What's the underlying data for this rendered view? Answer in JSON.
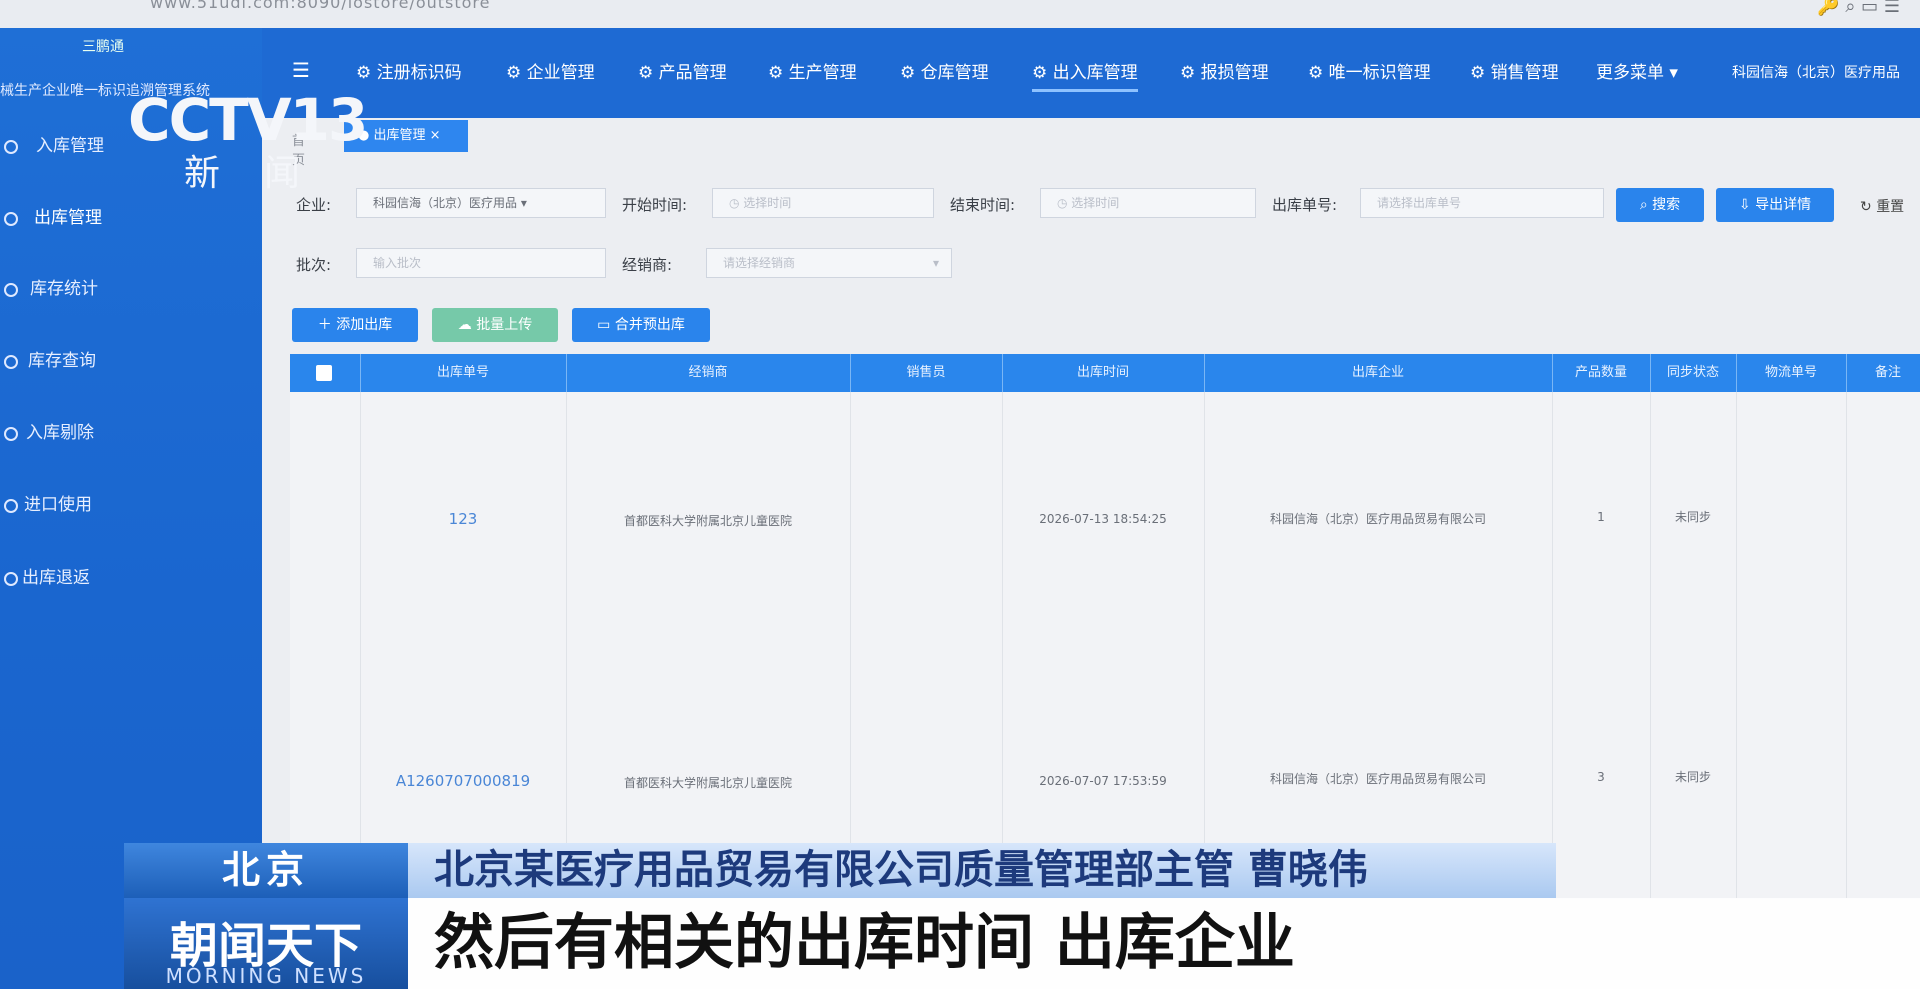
{
  "browser": {
    "url": "www.51udi.com:8090/iostore/outstore"
  },
  "sidebar": {
    "logo": "三鹏通",
    "system_title": "械生产企业唯一标识追溯管理系统",
    "items": [
      {
        "label": "入库管理"
      },
      {
        "label": "出库管理"
      },
      {
        "label": "库存统计"
      },
      {
        "label": "库存查询"
      },
      {
        "label": "入库剔除"
      },
      {
        "label": "进口使用"
      },
      {
        "label": "出库退返"
      }
    ]
  },
  "topnav": {
    "items": [
      {
        "label": "注册标识码"
      },
      {
        "label": "企业管理"
      },
      {
        "label": "产品管理"
      },
      {
        "label": "生产管理"
      },
      {
        "label": "仓库管理"
      },
      {
        "label": "出入库管理"
      },
      {
        "label": "报损管理"
      },
      {
        "label": "唯一标识管理"
      },
      {
        "label": "销售管理"
      },
      {
        "label": "更多菜单"
      }
    ],
    "company": "科园信海（北京）医疗用品"
  },
  "tabs": {
    "home": "首页",
    "active": "出库管理"
  },
  "filters": {
    "enterprise_label": "企业:",
    "enterprise_value": "科园信海（北京）医疗用品",
    "start_label": "开始时间:",
    "start_placeholder": "选择时间",
    "end_label": "结束时间:",
    "end_placeholder": "选择时间",
    "order_label": "出库单号:",
    "order_placeholder": "请选择出库单号",
    "batch_label": "批次:",
    "batch_placeholder": "输入批次",
    "dealer_label": "经销商:",
    "dealer_placeholder": "请选择经销商",
    "search_button": "搜索",
    "export_button": "导出详情",
    "reset_button": "重置"
  },
  "actions": {
    "add": "添加出库",
    "upload": "批量上传",
    "merge": "合并预出库"
  },
  "table": {
    "headers": [
      "出库单号",
      "经销商",
      "销售员",
      "出库时间",
      "出库企业",
      "产品数量",
      "同步状态",
      "物流单号",
      "备注"
    ],
    "rows": [
      {
        "order_no": "123",
        "dealer": "首都医科大学附属北京儿童医院",
        "salesperson": "",
        "time": "2026-07-13 18:54:25",
        "enterprise": "科园信海（北京）医疗用品贸易有限公司",
        "qty": "1",
        "sync": "未同步",
        "logistics": "",
        "note": ""
      },
      {
        "order_no": "A1260707000819",
        "dealer": "首都医科大学附属北京儿童医院",
        "salesperson": "",
        "time": "2026-07-07 17:53:59",
        "enterprise": "科园信海（北京）医疗用品贸易有限公司",
        "qty": "3",
        "sync": "未同步",
        "logistics": "",
        "note": ""
      }
    ]
  },
  "broadcast": {
    "channel": "CCTV13",
    "channel_sub": "新闻",
    "location": "北京",
    "speaker": "北京某医疗用品贸易有限公司质量管理部主管 曹晓伟",
    "program": "朝闻天下",
    "program_en": "MORNING NEWS",
    "subtitle": "然后有相关的出库时间 出库企业"
  }
}
